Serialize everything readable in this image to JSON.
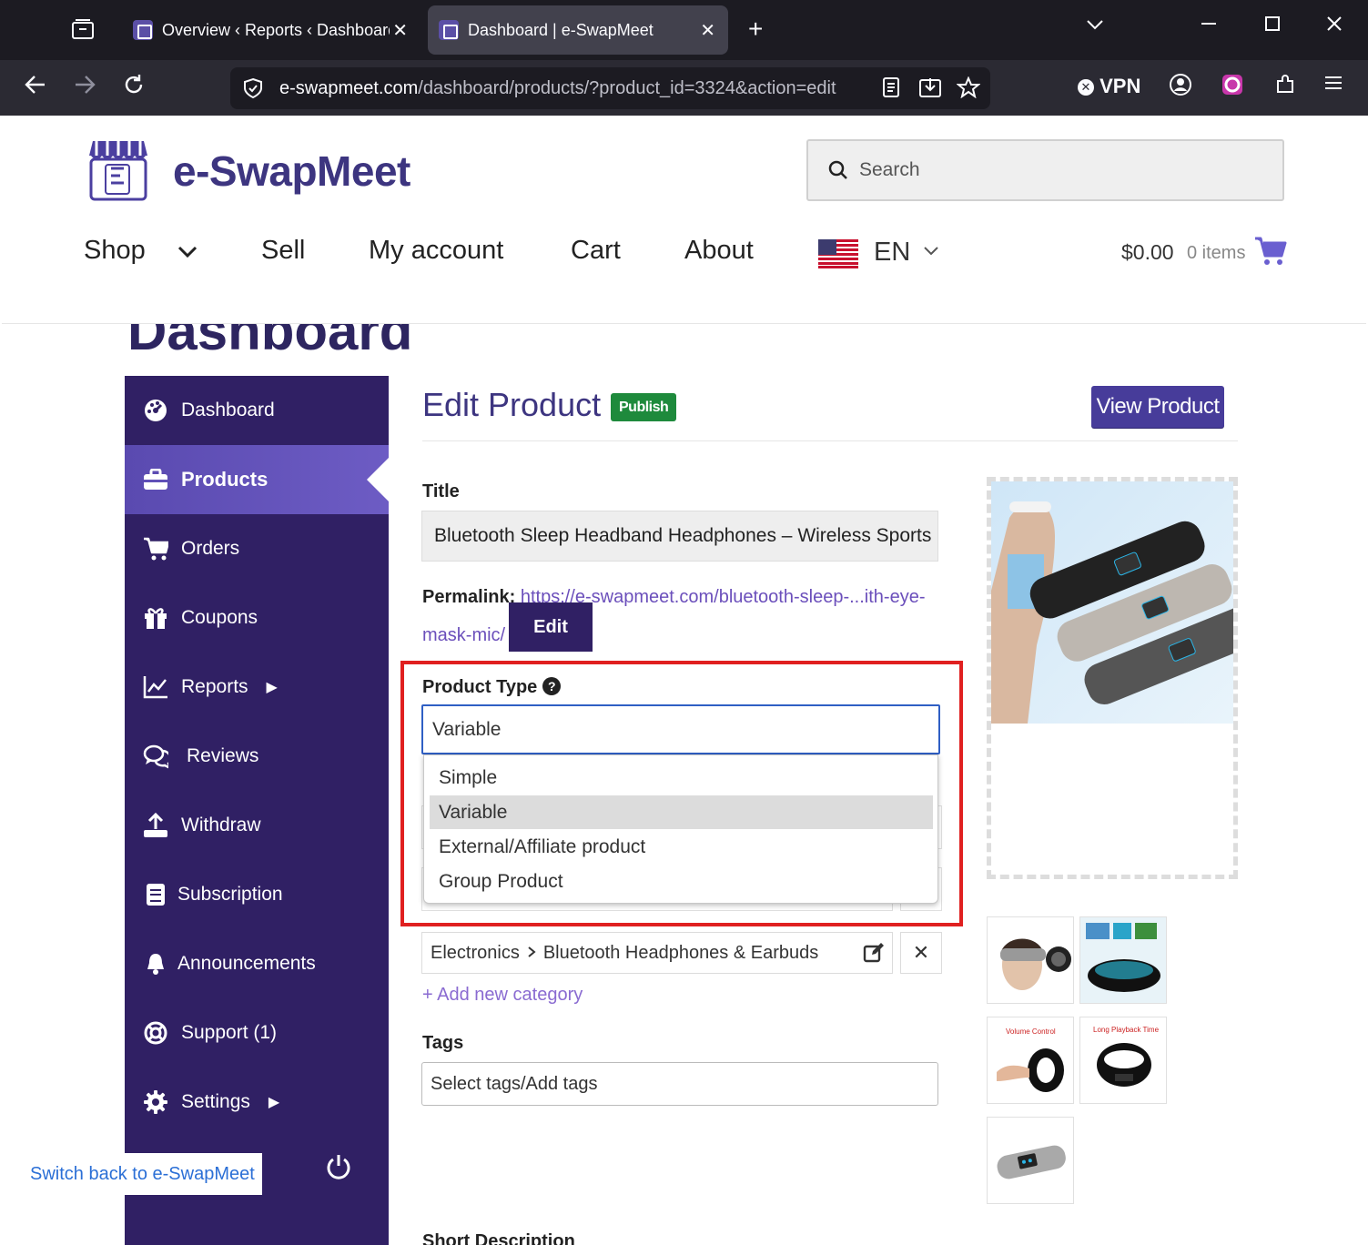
{
  "browser": {
    "tabs": [
      {
        "label": "Overview ‹ Reports ‹ Dashboard"
      },
      {
        "label": "Dashboard | e-SwapMeet"
      }
    ],
    "url_host": "e-swapmeet.com",
    "url_path": "/dashboard/products/?product_id=3324&action=edit",
    "vpn_label": "VPN"
  },
  "site": {
    "brand": "e-SwapMeet",
    "search_placeholder": "Search",
    "nav": {
      "shop": "Shop",
      "sell": "Sell",
      "my_account": "My account",
      "cart": "Cart",
      "about": "About",
      "language": "EN"
    },
    "cart_total": "$0.00",
    "cart_items": "0 items",
    "ghost_heading": "Dashboard"
  },
  "sidebar": {
    "items": [
      {
        "label": "Dashboard",
        "icon": "dashboard-icon"
      },
      {
        "label": "Products",
        "icon": "briefcase-icon"
      },
      {
        "label": "Orders",
        "icon": "cart-icon"
      },
      {
        "label": "Coupons",
        "icon": "gift-icon"
      },
      {
        "label": "Reports",
        "icon": "chart-icon"
      },
      {
        "label": "Reviews",
        "icon": "chat-icon"
      },
      {
        "label": "Withdraw",
        "icon": "upload-icon"
      },
      {
        "label": "Subscription",
        "icon": "book-icon"
      },
      {
        "label": "Announcements",
        "icon": "bell-icon"
      },
      {
        "label": "Support (1)",
        "icon": "lifebuoy-icon"
      },
      {
        "label": "Settings",
        "icon": "gear-icon"
      }
    ],
    "active": "Products",
    "switch_back": "Switch back to e-SwapMeet"
  },
  "main": {
    "title": "Edit Product",
    "status_badge": "Publish",
    "view_product": "View Product",
    "title_label": "Title",
    "title_value": "Bluetooth Sleep Headband Headphones – Wireless Sports",
    "permalink_label": "Permalink:",
    "permalink_url_1": "https://e-swapmeet.com/bluetooth-sleep-...ith-eye-",
    "permalink_url_2": "mask-mic/",
    "edit_button": "Edit",
    "product_type_label": "Product Type",
    "product_type_value": "Variable",
    "product_type_options": [
      "Simple",
      "Variable",
      "External/Affiliate product",
      "Group Product"
    ],
    "category_path_1": "Electronics",
    "category_path_2": "Bluetooth Headphones & Earbuds",
    "add_category": "+ Add new category",
    "tags_label": "Tags",
    "tags_placeholder": "Select tags/Add tags",
    "short_description_label": "Short Description"
  },
  "colors": {
    "brand": "#3d3580",
    "sidebar": "#302064",
    "highlight": "#e02020",
    "publish": "#1e8a3c"
  }
}
